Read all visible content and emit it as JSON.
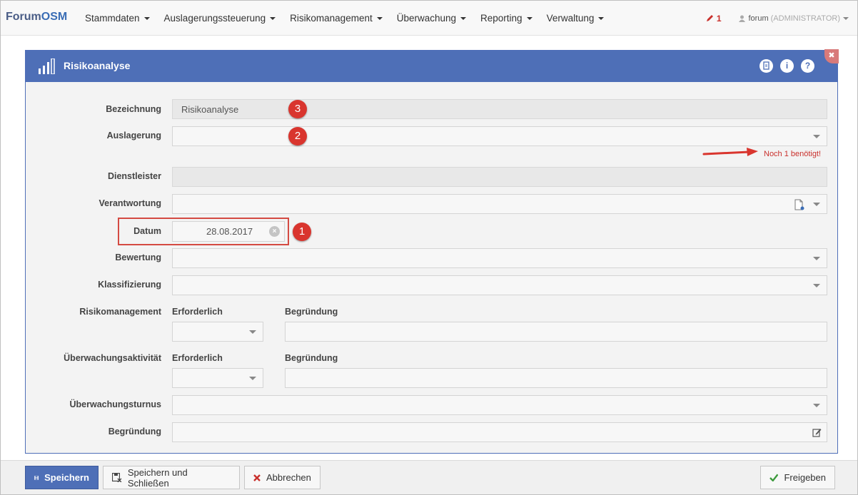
{
  "app": {
    "brand_prefix": "Forum",
    "brand_suffix": "OSM"
  },
  "nav": {
    "items": [
      {
        "label": "Stammdaten"
      },
      {
        "label": "Auslagerungssteuerung"
      },
      {
        "label": "Risikomanagement"
      },
      {
        "label": "Überwachung"
      },
      {
        "label": "Reporting"
      },
      {
        "label": "Verwaltung"
      }
    ],
    "edit_count": "1",
    "user": "forum",
    "role": "(ADMINISTRATOR)"
  },
  "panel": {
    "title": "Risikoanalyse",
    "colors": {
      "header": "#4e6fb7",
      "error": "#c9302c",
      "badge": "#d9352e"
    }
  },
  "form": {
    "bezeichnung": {
      "label": "Bezeichnung",
      "value": "Risikoanalyse"
    },
    "auslagerung": {
      "label": "Auslagerung",
      "value": "",
      "hint": "Noch 1 benötigt!"
    },
    "dienstleister": {
      "label": "Dienstleister",
      "value": ""
    },
    "verantwortung": {
      "label": "Verantwortung",
      "value": ""
    },
    "datum": {
      "label": "Datum",
      "value": "28.08.2017"
    },
    "bewertung": {
      "label": "Bewertung",
      "value": ""
    },
    "klassifizierung": {
      "label": "Klassifizierung",
      "value": ""
    },
    "risikomanagement": {
      "label": "Risikomanagement",
      "erforderlich": "Erforderlich",
      "begruendung": "Begründung"
    },
    "ueberwachungsaktivitaet": {
      "label": "Überwachungsaktivität",
      "erforderlich": "Erforderlich",
      "begruendung": "Begründung"
    },
    "ueberwachungsturnus": {
      "label": "Überwachungsturnus",
      "value": ""
    },
    "begruendung": {
      "label": "Begründung",
      "value": ""
    }
  },
  "annotations": {
    "one": "1",
    "two": "2",
    "three": "3"
  },
  "footer": {
    "save": "Speichern",
    "save_close": "Speichern und Schließen",
    "cancel": "Abbrechen",
    "release": "Freigeben"
  }
}
